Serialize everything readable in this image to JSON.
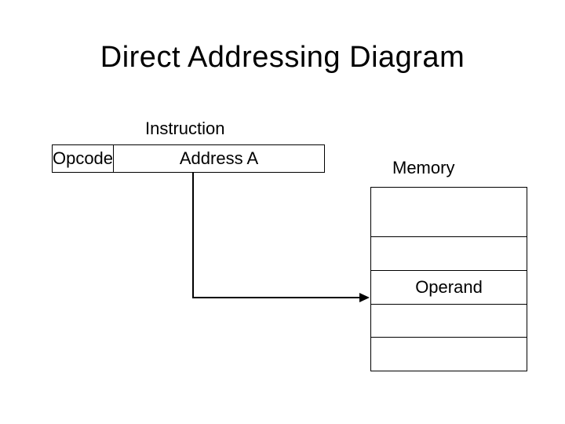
{
  "title": "Direct Addressing Diagram",
  "labels": {
    "instruction": "Instruction",
    "opcode": "Opcode",
    "address": "Address A",
    "memory": "Memory",
    "operand": "Operand"
  }
}
